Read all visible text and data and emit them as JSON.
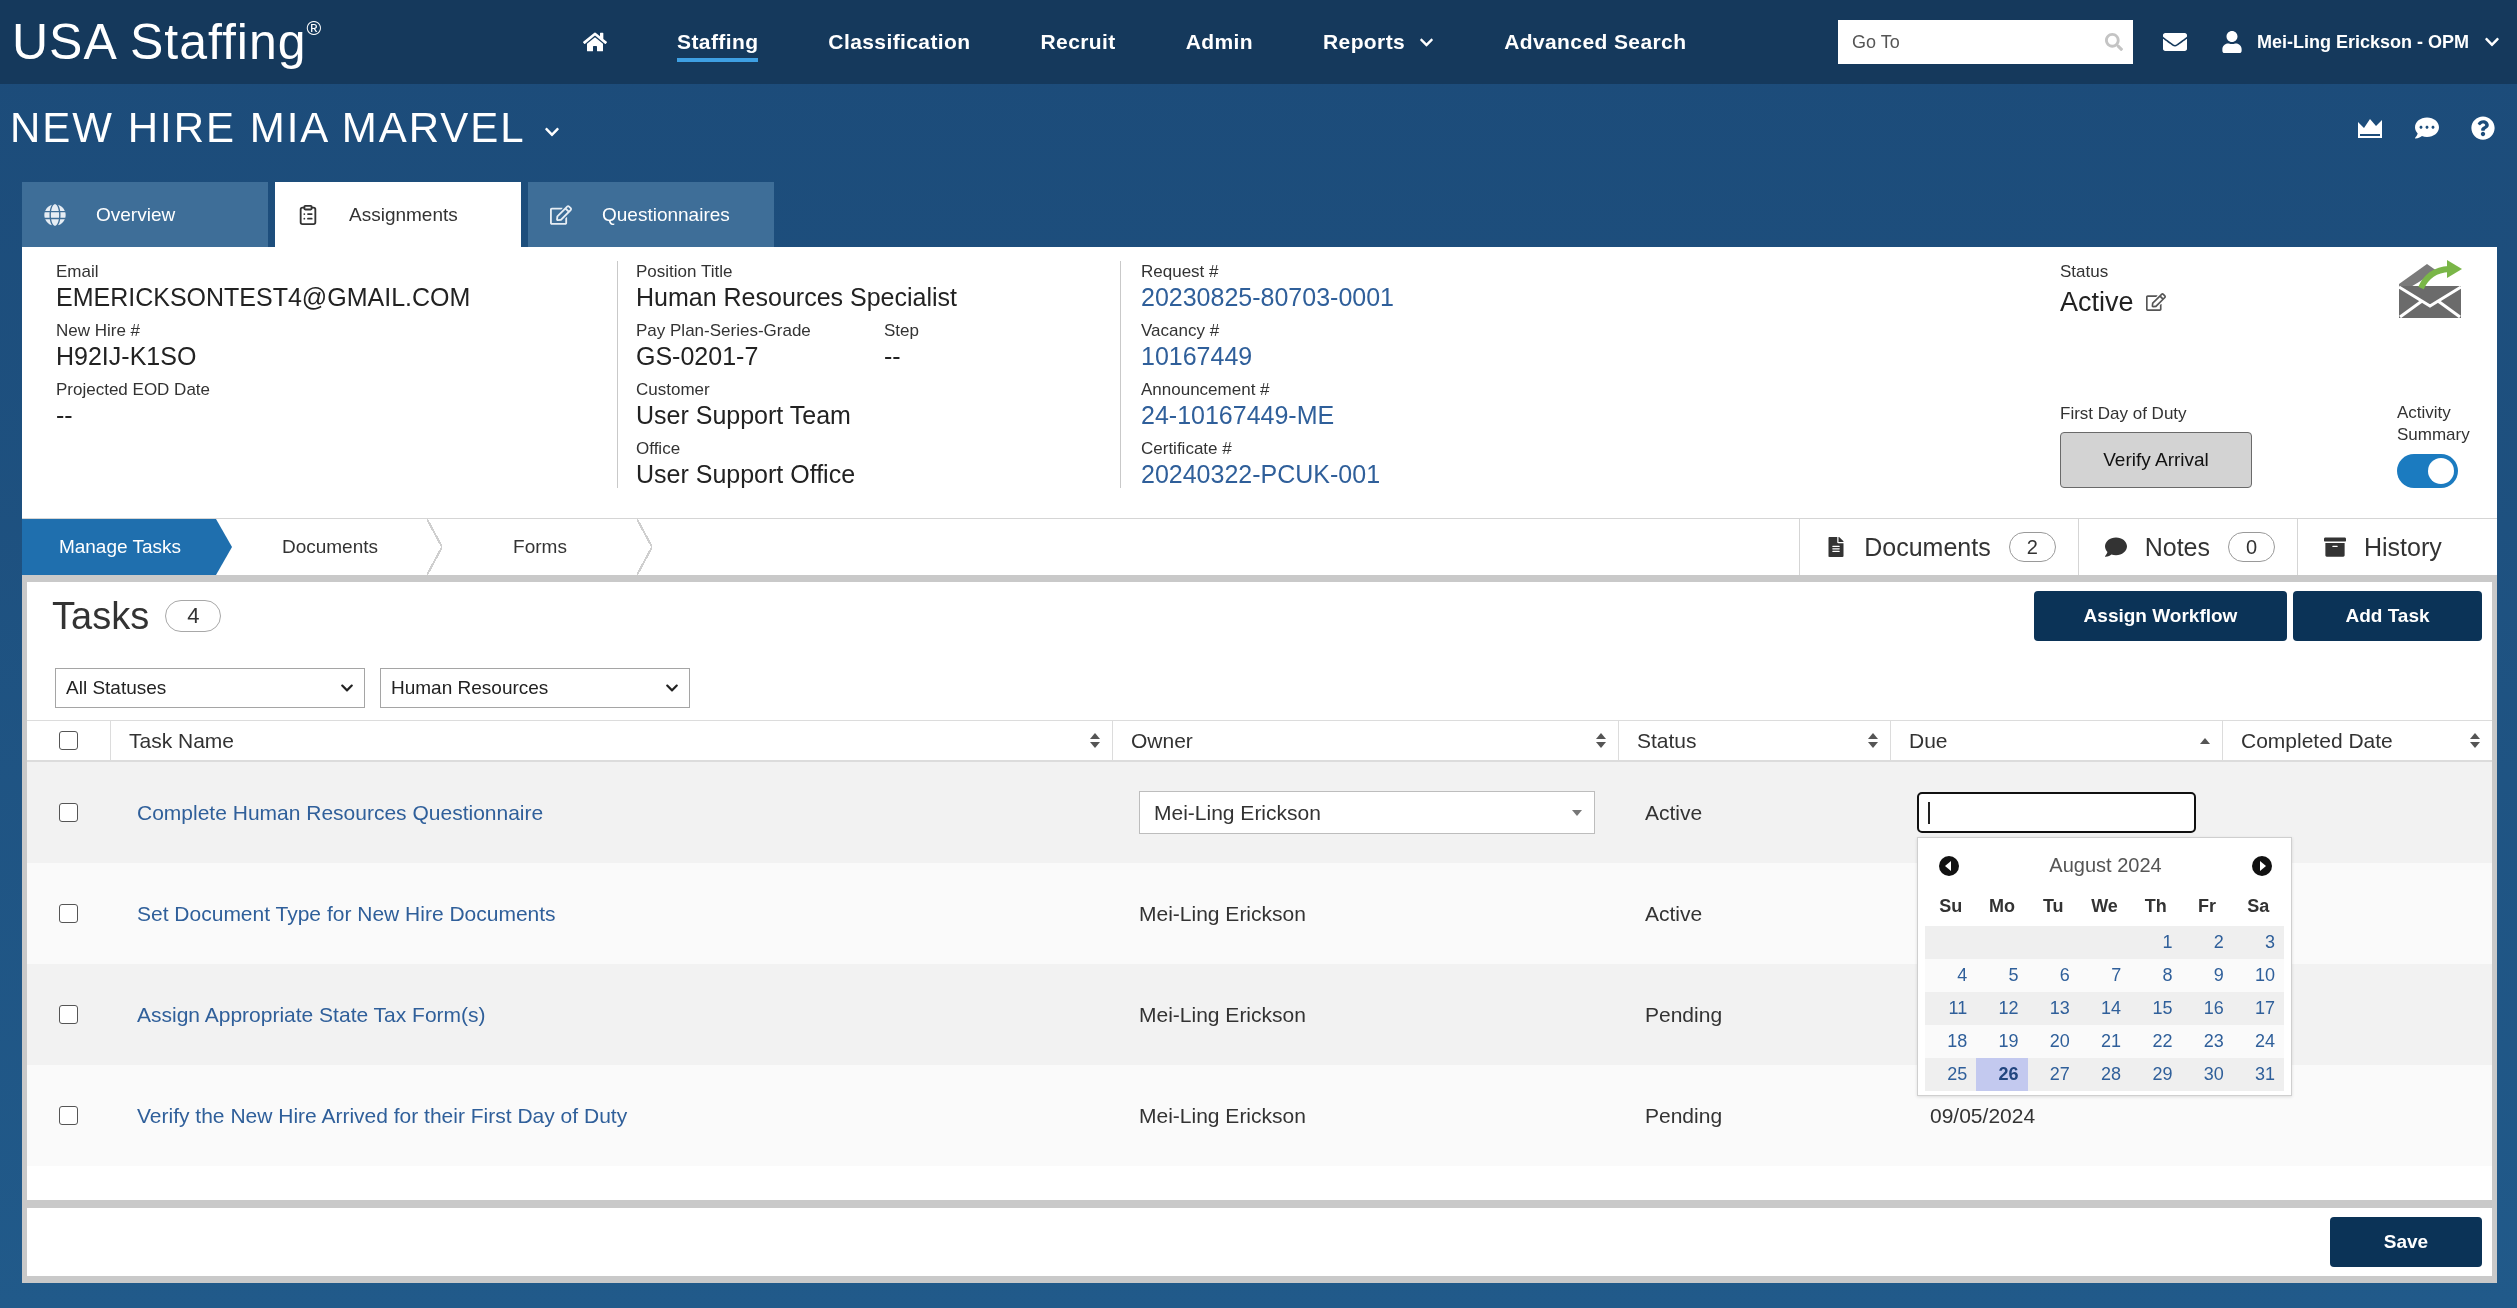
{
  "header": {
    "logo": "USA Staffing$^{®}$",
    "nav": [
      {
        "label": "Staffing",
        "selected": true,
        "has_menu": false
      },
      {
        "label": "Classification",
        "selected": false,
        "has_menu": false
      },
      {
        "label": "Recruit",
        "selected": false,
        "has_menu": false
      },
      {
        "label": "Admin",
        "selected": false,
        "has_menu": false
      },
      {
        "label": "Reports",
        "selected": false,
        "has_menu": true
      },
      {
        "label": "Advanced Search",
        "selected": false,
        "has_menu": false
      }
    ],
    "search": {
      "placeholder": "Go To"
    },
    "user": "Mei-Ling Erickson - OPM"
  },
  "page_title": "NEW HIRE MIA MARVEL",
  "tabs": [
    {
      "label": "Overview",
      "selected": false
    },
    {
      "label": "Assignments",
      "selected": true
    },
    {
      "label": "Questionnaires",
      "selected": false
    }
  ],
  "details": {
    "columns": [
      {
        "rows": [
          [
            {
              "label": "Email",
              "value": "EMERICKSONTEST4@GMAIL.COM",
              "link": false
            }
          ],
          [
            {
              "label": "New Hire #",
              "value": "H92IJ-K1SO",
              "link": false
            }
          ],
          [
            {
              "label": "Projected EOD Date",
              "value": "--",
              "link": false
            }
          ]
        ]
      },
      {
        "rows": [
          [
            {
              "label": "Position Title",
              "value": "Human Resources Specialist",
              "link": false
            }
          ],
          [
            {
              "label": "Pay Plan-Series-Grade",
              "value": "GS-0201-7",
              "link": false
            },
            {
              "label": "Step",
              "value": "--",
              "link": false
            }
          ],
          [
            {
              "label": "Customer",
              "value": "User Support Team",
              "link": false
            }
          ],
          [
            {
              "label": "Office",
              "value": "User Support Office",
              "link": false
            }
          ]
        ]
      },
      {
        "rows": [
          [
            {
              "label": "Request #",
              "value": "20230825-80703-0001",
              "link": true
            }
          ],
          [
            {
              "label": "Vacancy #",
              "value": "10167449",
              "link": true
            }
          ],
          [
            {
              "label": "Announcement #",
              "value": "24-10167449-ME",
              "link": true
            }
          ],
          [
            {
              "label": "Certificate #",
              "value": "20240322-PCUK-001",
              "link": true
            }
          ]
        ]
      }
    ],
    "status": {
      "label": "Status",
      "value": "Active"
    },
    "first_day": {
      "label": "First Day of Duty",
      "button": "Verify Arrival"
    },
    "activity_summary": {
      "label": "Activity Summary",
      "on": true
    }
  },
  "subnav": {
    "steps": [
      {
        "label": "Manage Tasks",
        "selected": true
      },
      {
        "label": "Documents",
        "selected": false
      },
      {
        "label": "Forms",
        "selected": false
      }
    ],
    "side_tabs": [
      {
        "label": "Documents",
        "count": "2"
      },
      {
        "label": "Notes",
        "count": "0"
      },
      {
        "label": "History"
      }
    ]
  },
  "tasks": {
    "title": "Tasks",
    "count": "4",
    "buttons": [
      "Assign Workflow",
      "Add Task"
    ],
    "filters": [
      {
        "value": "All Statuses"
      },
      {
        "value": "Human Resources"
      }
    ],
    "table": {
      "select_all": {
        "checked": false
      },
      "columns": [
        {
          "label": "Task Name",
          "sorted": false
        },
        {
          "label": "Owner",
          "sorted": false
        },
        {
          "label": "Status",
          "sorted": false
        },
        {
          "label": "Due",
          "sorted": true
        },
        {
          "label": "Completed Date",
          "sorted": false
        }
      ],
      "rows": [
        {
          "checked": false,
          "task": "Complete Human Resources Questionnaire",
          "owner": "Mei-Ling Erickson",
          "status": "Active",
          "editing": true
        },
        {
          "checked": false,
          "task": "Set Document Type for New Hire Documents",
          "owner": "Mei-Ling Erickson",
          "status": "Active",
          "editing": false
        },
        {
          "checked": false,
          "task": "Assign Appropriate State Tax Form(s)",
          "owner": "Mei-Ling Erickson",
          "status": "Pending",
          "editing": false
        },
        {
          "checked": false,
          "task": "Verify the New Hire Arrived for their First Day of Duty",
          "owner": "Mei-Ling Erickson",
          "status": "Pending",
          "due": "09/05/2024",
          "editing": false
        }
      ]
    },
    "date_picker": {
      "month": "August 2024",
      "weekdays": [
        "Su",
        "Mo",
        "Tu",
        "We",
        "Th",
        "Fr",
        "Sa"
      ],
      "weeks": [
        [
          {
            "day": "1",
            "selected": false
          },
          {
            "day": "2",
            "selected": false
          },
          {
            "day": "3",
            "selected": false
          }
        ],
        [
          {
            "day": "4",
            "selected": false
          },
          {
            "day": "5",
            "selected": false
          },
          {
            "day": "6",
            "selected": false
          },
          {
            "day": "7",
            "selected": false
          },
          {
            "day": "8",
            "selected": false
          },
          {
            "day": "9",
            "selected": false
          },
          {
            "day": "10",
            "selected": false
          }
        ],
        [
          {
            "day": "11",
            "selected": false
          },
          {
            "day": "12",
            "selected": false
          },
          {
            "day": "13",
            "selected": false
          },
          {
            "day": "14",
            "selected": false
          },
          {
            "day": "15",
            "selected": false
          },
          {
            "day": "16",
            "selected": false
          },
          {
            "day": "17",
            "selected": false
          }
        ],
        [
          {
            "day": "18",
            "selected": false
          },
          {
            "day": "19",
            "selected": false
          },
          {
            "day": "20",
            "selected": false
          },
          {
            "day": "21",
            "selected": false
          },
          {
            "day": "22",
            "selected": false
          },
          {
            "day": "23",
            "selected": false
          },
          {
            "day": "24",
            "selected": false
          }
        ],
        [
          {
            "day": "25",
            "selected": false
          },
          {
            "day": "26",
            "selected": true
          },
          {
            "day": "27",
            "selected": false
          },
          {
            "day": "28",
            "selected": false
          },
          {
            "day": "29",
            "selected": false
          },
          {
            "day": "30",
            "selected": false
          },
          {
            "day": "31",
            "selected": false
          }
        ]
      ]
    }
  },
  "footer": {
    "button": "Save"
  }
}
